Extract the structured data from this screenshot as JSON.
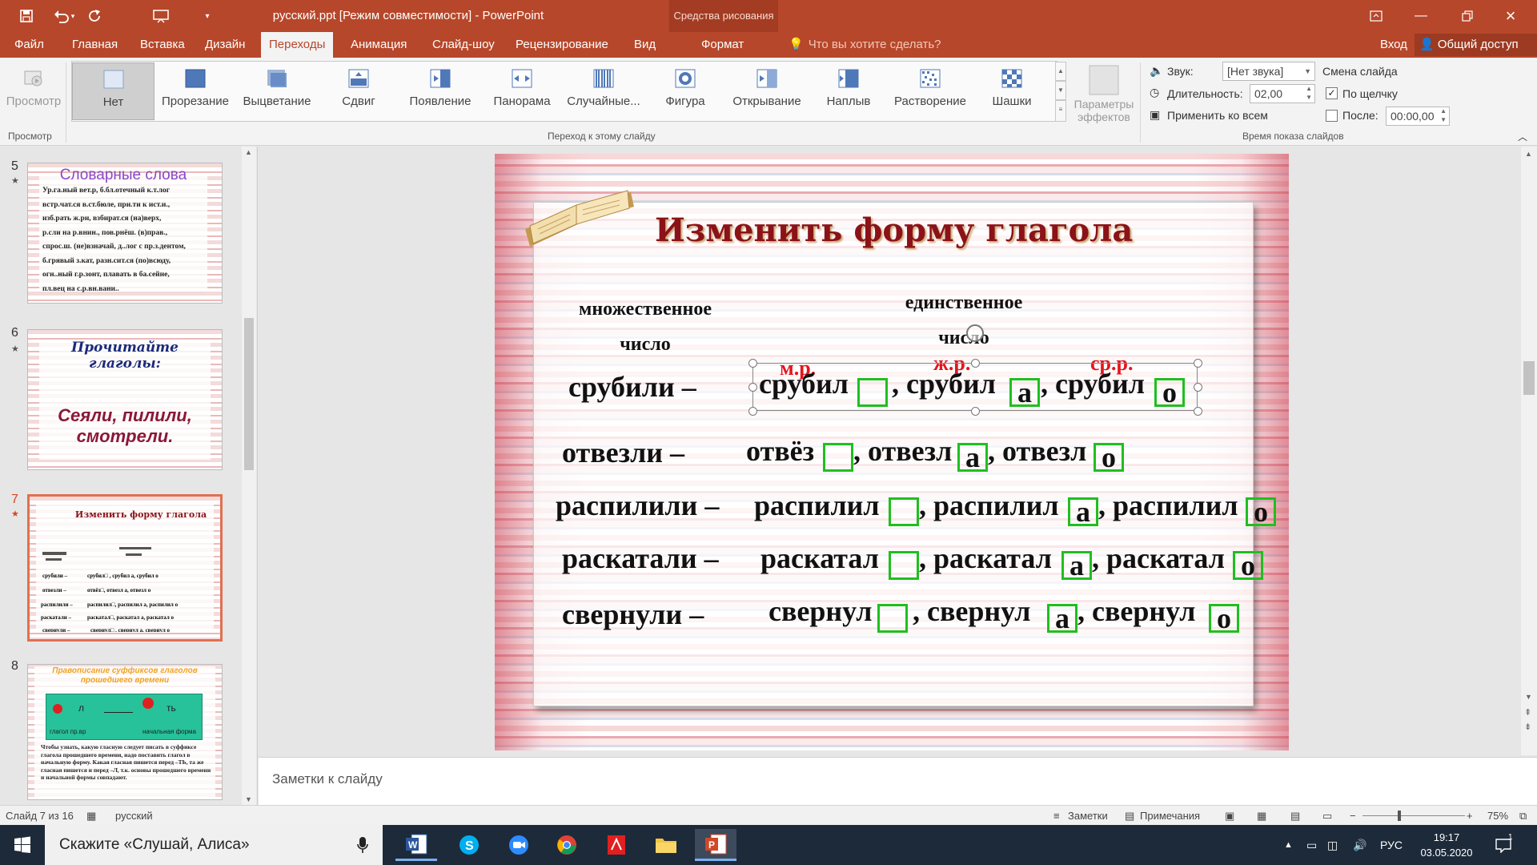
{
  "titlebar": {
    "title": "русский.ppt [Режим совместимости] - PowerPoint",
    "drawing_tools": "Средства рисования"
  },
  "tabs": [
    {
      "label": "Файл"
    },
    {
      "label": "Главная"
    },
    {
      "label": "Вставка"
    },
    {
      "label": "Дизайн"
    },
    {
      "label": "Переходы"
    },
    {
      "label": "Анимация"
    },
    {
      "label": "Слайд-шоу"
    },
    {
      "label": "Рецензирование"
    },
    {
      "label": "Вид"
    },
    {
      "label": "Формат"
    }
  ],
  "active_tab": "Переходы",
  "tell_me": "Что вы хотите сделать?",
  "sign_in": "Вход",
  "share": "Общий доступ",
  "ribbon": {
    "preview": "Просмотр",
    "preview_group": "Просмотр",
    "transitions": [
      {
        "label": "Нет",
        "icon": "none-transition-icon"
      },
      {
        "label": "Прорезание",
        "icon": "cut-transition-icon"
      },
      {
        "label": "Выцветание",
        "icon": "fade-transition-icon"
      },
      {
        "label": "Сдвиг",
        "icon": "push-transition-icon"
      },
      {
        "label": "Появление",
        "icon": "wipe-transition-icon"
      },
      {
        "label": "Панорама",
        "icon": "split-transition-icon"
      },
      {
        "label": "Случайные...",
        "icon": "random-bars-icon"
      },
      {
        "label": "Фигура",
        "icon": "shape-transition-icon"
      },
      {
        "label": "Открывание",
        "icon": "uncover-transition-icon"
      },
      {
        "label": "Наплыв",
        "icon": "cover-transition-icon"
      },
      {
        "label": "Растворение",
        "icon": "dissolve-transition-icon"
      },
      {
        "label": "Шашки",
        "icon": "checkerboard-transition-icon"
      }
    ],
    "transition_group": "Переход к этому слайду",
    "effect_options_1": "Параметры",
    "effect_options_2": "эффектов",
    "sound_label": "Звук:",
    "sound_value": "[Нет звука]",
    "duration_label": "Длительность:",
    "duration_value": "02,00",
    "apply_all": "Применить ко всем",
    "advance_title": "Смена слайда",
    "on_click": "По щелчку",
    "on_click_checked": true,
    "after_label": "После:",
    "after_value": "00:00,00",
    "after_checked": false,
    "timing_group": "Время показа слайдов"
  },
  "thumbnails": [
    {
      "num": "5",
      "title": "Словарные слова",
      "lines": [
        "Ур.га.ный вет.р,    б.бл.отечный к.т.лог",
        "встр.чат.ся в.ст.бюле,    при.ти к ист.и.,",
        "изб.рать ж.ри,    взбират.ся (на)верх,",
        "р.сли на р.внин.,    пов.рнёш. (в)прав.,",
        "спрос.ш. (не)взначай, д..лог с пр.з.дентом,",
        "б.грявый з.кат,    разн.сит.ся (по)всюду,",
        "огн..ный г.р.зонт,    плавать в ба.сейне,",
        "пл.вец на с.р.вн.вани.."
      ]
    },
    {
      "num": "6",
      "title": "Прочитайте глаголы:",
      "body": "Сеяли, пилили, смотрели."
    },
    {
      "num": "7",
      "title": "Изменить форму глагола"
    },
    {
      "num": "8",
      "title": "Правописание суффиксов глаголов прошедшего времени",
      "diagram_left": "л",
      "diagram_right": "ть",
      "caption_left": "глагол пр.вр",
      "caption_right": "начальная форма",
      "text": "Чтобы узнать, какую гласную следует писать в суффиксе глагола прошедшего времени, надо поставить глагол в начальную форму. Какая гласная пишется перед –ТЬ, та же гласная пишется и перед –Л, т.к. основы прошедшего времени и начальной формы совпадают."
    }
  ],
  "slide": {
    "title": "Изменить форму глагола",
    "plural_header_1": "множественное",
    "plural_header_2": "число",
    "singular_header_1": "единственное",
    "singular_header_2": "число",
    "genders": {
      "m": "м.р.",
      "f": "ж.р.",
      "n": "ср.р."
    },
    "rows": [
      {
        "plural": "срубили –",
        "m": "срубил",
        "f": ", срубил",
        "f_letter": "а",
        "n": ", срубил",
        "n_letter": "о"
      },
      {
        "plural": "отвезли –",
        "m": "отвёз",
        "f": ", отвезл",
        "f_letter": "а",
        "n": ", отвезл",
        "n_letter": "о"
      },
      {
        "plural": "распилили –",
        "m": "распилил",
        "f": ", распилил",
        "f_letter": "а",
        "n": ", распилил",
        "n_letter": "о"
      },
      {
        "plural": "раскатали –",
        "m": "раскатал",
        "f": ", раскатал",
        "f_letter": "а",
        "n": ", раскатал",
        "n_letter": "о"
      },
      {
        "plural": "свернули –",
        "m": "свернул",
        "f": ", свернул",
        "f_letter": "а",
        "n": ", свернул",
        "n_letter": "о"
      }
    ]
  },
  "notes_placeholder": "Заметки к слайду",
  "status": {
    "slide_of": "Слайд 7 из 16",
    "language": "русский",
    "notes": "Заметки",
    "comments": "Примечания",
    "zoom": "75%"
  },
  "taskbar": {
    "search": "Скажите «Слушай, Алиса»",
    "lang": "РУС",
    "time": "19:17",
    "date": "03.05.2020",
    "notification_count": "1"
  },
  "colors": {
    "accent": "#b7472a",
    "title_red": "#8b1218",
    "gender_red": "#e3161d",
    "box_green": "#1fbf1f"
  }
}
